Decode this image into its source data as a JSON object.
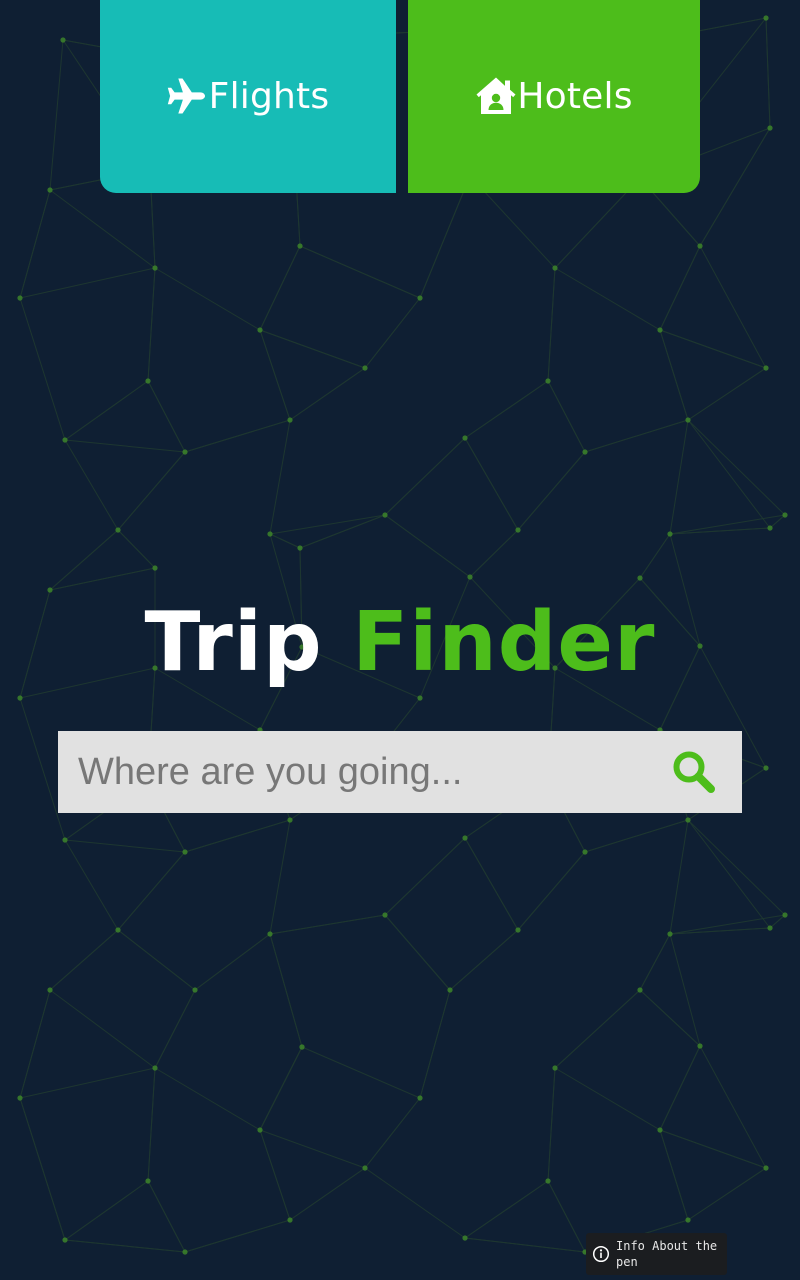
{
  "tabs": [
    {
      "label": "Flights",
      "icon": "plane-icon",
      "color": "#17bcb6"
    },
    {
      "label": "Hotels",
      "icon": "house-user-icon",
      "color": "#4dbd1b"
    }
  ],
  "title": {
    "part1": "Trip",
    "part2": "Finder",
    "part1_color": "#ffffff",
    "part2_color": "#4dbd1b"
  },
  "search": {
    "placeholder": "Where are you going...",
    "value": "",
    "button_icon": "search-icon",
    "button_color": "#4dbd1b"
  },
  "info_badge": {
    "text": "Info About the pen",
    "icon": "info-icon"
  },
  "colors": {
    "background": "#0f1f33",
    "network_lines": "#2a4a2e",
    "network_dots": "#3f8a2a"
  }
}
